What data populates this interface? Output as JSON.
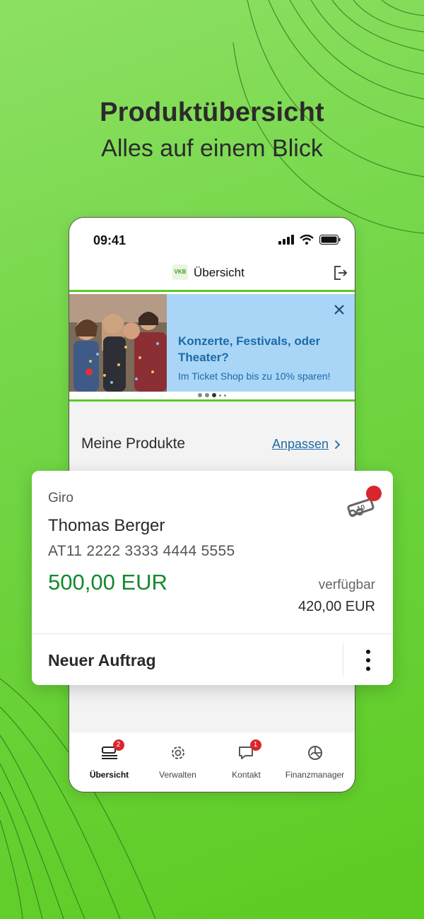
{
  "headline": {
    "title": "Produktübersicht",
    "subtitle": "Alles auf einem Blick"
  },
  "phone": {
    "status_time": "09:41",
    "app_title": "Übersicht",
    "logo_text": "VKB",
    "banner": {
      "headline": "Konzerte, Festivals, oder Theater?",
      "subline": "Im Ticket Shop bis zu 10% sparen!",
      "active_dot": 3
    },
    "section": {
      "title": "Meine Produkte",
      "adjust_label": "Anpassen"
    },
    "tabs": [
      {
        "label": "Übersicht",
        "icon": "overview-icon",
        "badge": "2",
        "active": true
      },
      {
        "label": "Verwalten",
        "icon": "gear-icon",
        "badge": "",
        "active": false
      },
      {
        "label": "Kontakt",
        "icon": "chat-icon",
        "badge": "1",
        "active": false
      },
      {
        "label": "Finanzmanager",
        "icon": "finance-icon",
        "badge": "",
        "active": false
      }
    ]
  },
  "card": {
    "category": "Giro",
    "holder": "Thomas Berger",
    "iban": "AT11 2222 3333 4444 5555",
    "balance": "500,00 EUR",
    "available_label": "verfügbar",
    "available_value": "420,00 EUR",
    "action_label": "Neuer Auftrag",
    "ticket_icon": "ticket-icon",
    "notification_color": "#d9262c"
  },
  "colors": {
    "accent_green": "#5ccb22",
    "balance_green": "#128a2e",
    "link_blue": "#1d6aa7",
    "banner_blue": "#a9d6f7"
  }
}
